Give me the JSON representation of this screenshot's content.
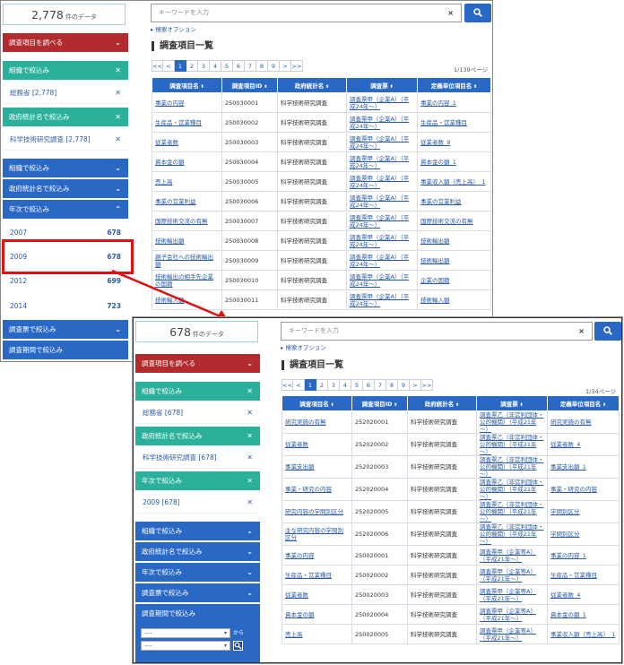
{
  "screen1": {
    "count": {
      "value": "2,778",
      "unit": "件のデータ"
    },
    "sidebar": {
      "research_items": "調査項目を調べる",
      "filter_org_active": "組織で絞込み",
      "org_selected": "総務省 [2,778]",
      "filter_stat_active": "政府統計名で絞込み",
      "stat_selected": "科学技術研究調査 [2,778]",
      "filter_org": "組織で絞込み",
      "filter_stat": "政府統計名で絞込み",
      "filter_year": "年次で絞込み",
      "years": [
        {
          "year": "2007",
          "count": "678"
        },
        {
          "year": "2009",
          "count": "678"
        },
        {
          "year": "2012",
          "count": "699"
        },
        {
          "year": "2014",
          "count": "723"
        }
      ],
      "filter_survey": "調査票で絞込み",
      "filter_period": "調査期間で絞込み"
    },
    "search": {
      "placeholder": "キーワードを入力",
      "clear": "×",
      "options": "検索オプション"
    },
    "page_title": "調査項目一覧",
    "pager": [
      "<<",
      "<",
      "1",
      "2",
      "3",
      "4",
      "5",
      "6",
      "7",
      "8",
      "9",
      ">",
      ">>"
    ],
    "page_count": "1/139ページ",
    "headers": [
      "調査項目名",
      "調査項目ID",
      "政府統計名",
      "調査票",
      "定義単位項目名"
    ],
    "rows": [
      [
        "事業の内容",
        "250030001",
        "科学技術研究調査",
        "調査票甲（企業A）（平成24年～）",
        "事業の内容_1"
      ],
      [
        "生産品・営業種目",
        "250030002",
        "科学技術研究調査",
        "調査票甲（企業A）（平成24年～）",
        "生産品・営業種目"
      ],
      [
        "従業者数",
        "250030003",
        "科学技術研究調査",
        "調査票甲（企業A）（平成24年～）",
        "従業者数_9"
      ],
      [
        "資本金の額",
        "250030004",
        "科学技術研究調査",
        "調査票甲（企業A）（平成24年～）",
        "資本金の額_1"
      ],
      [
        "売上高",
        "250030005",
        "科学技術研究調査",
        "調査票甲（企業A）（平成24年～）",
        "事業収入額（売上高）_1"
      ],
      [
        "事業の営業利益",
        "250030006",
        "科学技術研究調査",
        "調査票甲（企業A）（平成24年～）",
        "事業の営業利益"
      ],
      [
        "国際技術交流の有無",
        "250030007",
        "科学技術研究調査",
        "調査票甲（企業A）（平成24年～）",
        "国際技術交流の有無"
      ],
      [
        "技術輸出額",
        "250030008",
        "科学技術研究調査",
        "調査票甲（企業A）（平成24年～）",
        "技術輸出額"
      ],
      [
        "親子会社への技術輸出額",
        "250030009",
        "科学技術研究調査",
        "調査票甲（企業A）（平成24年～）",
        "技術輸出額"
      ],
      [
        "技術輸出の相手先企業の国籍",
        "250030010",
        "科学技術研究調査",
        "調査票甲（企業A）（平成24年～）",
        "企業の国籍"
      ],
      [
        "技術輸入額",
        "250030011",
        "科学技術研究調査",
        "調査票甲（企業A）（平成24年～）",
        "技術輸入額"
      ]
    ]
  },
  "screen2": {
    "count": {
      "value": "678",
      "unit": "件のデータ"
    },
    "sidebar": {
      "research_items": "調査項目を調べる",
      "filter_org_active": "組織で絞込み",
      "org_selected": "総務省 [678]",
      "filter_stat_active": "政府統計名で絞込み",
      "stat_selected": "科学技術研究調査 [678]",
      "filter_year_active": "年次で絞込み",
      "year_selected": "2009 [678]",
      "filter_org": "組織で絞込み",
      "filter_stat": "政府統計名で絞込み",
      "filter_year": "年次で絞込み",
      "filter_survey": "調査票で絞込み",
      "filter_period": "調査期間で絞込み",
      "period_from": "----",
      "period_to": "----",
      "from_label": "から"
    },
    "search": {
      "placeholder": "キーワードを入力",
      "clear": "×",
      "options": "検索オプション"
    },
    "page_title": "調査項目一覧",
    "pager": [
      "<<",
      "<",
      "1",
      "2",
      "3",
      "4",
      "5",
      "6",
      "7",
      "8",
      "9",
      ">",
      ">>"
    ],
    "page_count": "1/34ページ",
    "headers": [
      "調査項目名",
      "調査項目ID",
      "政府統計名",
      "調査票",
      "定義単位項目名"
    ],
    "rows": [
      [
        "研究実施の有無",
        "252020001",
        "科学技術研究調査",
        "調査票乙（非営利団体・公的機関）（平成21年～）",
        "研究実施の有無"
      ],
      [
        "従業者数",
        "252020002",
        "科学技術研究調査",
        "調査票乙（非営利団体・公的機関）（平成21年～）",
        "従業者数_4"
      ],
      [
        "事業支出額",
        "252020003",
        "科学技術研究調査",
        "調査票乙（非営利団体・公的機関）（平成21年～）",
        "事業支出額_1"
      ],
      [
        "事業・研究の内容",
        "252020004",
        "科学技術研究調査",
        "調査票乙（非営利団体・公的機関）（平成21年～）",
        "事業・研究の内容"
      ],
      [
        "研究内容の学問別区分",
        "252020005",
        "科学技術研究調査",
        "調査票乙（非営利団体・公的機関）（平成21年～）",
        "学問別区分"
      ],
      [
        "主な研究内容の学問別区分",
        "252020006",
        "科学技術研究調査",
        "調査票乙（非営利団体・公的機関）（平成21年～）",
        "学問別区分"
      ],
      [
        "事業の内容",
        "250020001",
        "科学技術研究調査",
        "調査票甲（企業等A）（平成21年～）",
        "事業の内容_1"
      ],
      [
        "生産品・営業種目",
        "250020002",
        "科学技術研究調査",
        "調査票甲（企業等A）（平成21年～）",
        "生産品・営業種目"
      ],
      [
        "従業者数",
        "250020003",
        "科学技術研究調査",
        "調査票甲（企業等A）（平成21年～）",
        "従業者数_4"
      ],
      [
        "資本金の額",
        "250020004",
        "科学技術研究調査",
        "調査票甲（企業等A）（平成21年～）",
        "資本金の額_1"
      ],
      [
        "売上高",
        "250020005",
        "科学技術研究調査",
        "調査票甲（企業等A）（平成21年～）",
        "事業収入額（売上高）_1"
      ]
    ]
  }
}
